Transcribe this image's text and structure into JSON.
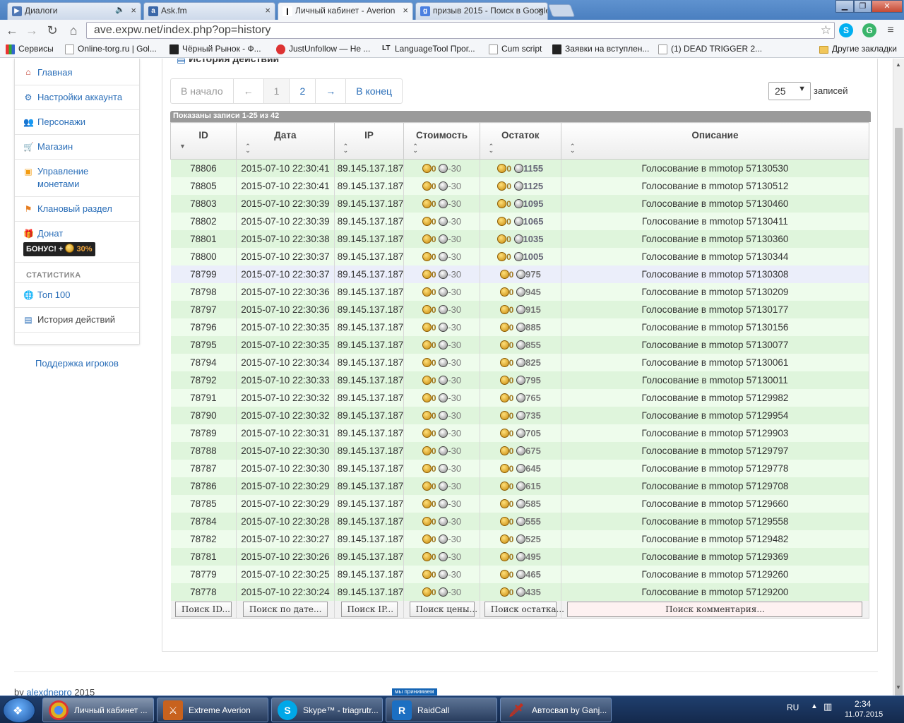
{
  "browser": {
    "tabs": [
      {
        "label": "Диалоги",
        "icon": "play-icon",
        "color": "#4f78b5"
      },
      {
        "label": "Ask.fm",
        "icon": "ask-icon",
        "color": "#3a67a8"
      },
      {
        "label": "Личный кабинет - Averion",
        "icon": "info-icon",
        "color": "#222222"
      },
      {
        "label": "призыв 2015 - Поиск в Google",
        "icon": "google-icon",
        "color": "#4a7fe0"
      }
    ],
    "url": "ave.expw.net/index.php?op=history",
    "bookmarks": [
      {
        "label": "Сервисы"
      },
      {
        "label": "Online-torg.ru | Gol..."
      },
      {
        "label": "Чёрный Рынок - Ф..."
      },
      {
        "label": "JustUnfollow — Не ..."
      },
      {
        "label": "LanguageTool Прог..."
      },
      {
        "label": "Cum script"
      },
      {
        "label": "Заявки на вступлен..."
      },
      {
        "label": "(1) DEAD TRIGGER 2..."
      },
      {
        "label": "Другие закладки"
      }
    ]
  },
  "sidebar": {
    "items": [
      {
        "label": "Главная",
        "icon": "home-icon"
      },
      {
        "label": "Настройки аккаунта",
        "icon": "gear-icon"
      },
      {
        "label": "Персонажи",
        "icon": "users-icon"
      },
      {
        "label": "Магазин",
        "icon": "cart-icon"
      },
      {
        "label": "Управление монетами",
        "icon": "coins-icon"
      },
      {
        "label": "Клановый раздел",
        "icon": "flag-icon"
      },
      {
        "label": "Донат",
        "icon": "gift-icon"
      }
    ],
    "bonus": {
      "text": "БОНУС! +",
      "pct": "30%"
    },
    "stats_heading": "СТАТИСТИКА",
    "stats_items": [
      {
        "label": "Топ 100",
        "icon": "globe-icon"
      },
      {
        "label": "История действий",
        "icon": "document-icon"
      }
    ],
    "support": "Поддержка игроков"
  },
  "panel": {
    "title": "История действий",
    "pager": {
      "first": "В начало",
      "prev": "←",
      "page1": "1",
      "page2": "2",
      "next": "→",
      "last": "В конец"
    },
    "per_page_value": "25",
    "per_page_label": "записей",
    "shown": "Показаны записи 1-25 из 42",
    "columns": [
      "ID",
      "Дата",
      "IP",
      "Стоимость",
      "Остаток",
      "Описание"
    ],
    "filters": [
      "Поиск ID...",
      "Поиск по дате...",
      "Поиск IP...",
      "Поиск цены...",
      "Поиск остатка...",
      "Поиск комментария..."
    ]
  },
  "rows": [
    {
      "id": "78806",
      "date": "2015-07-10 22:30:41",
      "ip": "89.145.137.187",
      "cost_gold": "0",
      "cost_silver": "-30",
      "bal_gold": "0",
      "bal_silver": "1155",
      "desc": "Голосование в mmotop 57130530"
    },
    {
      "id": "78805",
      "date": "2015-07-10 22:30:41",
      "ip": "89.145.137.187",
      "cost_gold": "0",
      "cost_silver": "-30",
      "bal_gold": "0",
      "bal_silver": "1125",
      "desc": "Голосование в mmotop 57130512"
    },
    {
      "id": "78803",
      "date": "2015-07-10 22:30:39",
      "ip": "89.145.137.187",
      "cost_gold": "0",
      "cost_silver": "-30",
      "bal_gold": "0",
      "bal_silver": "1095",
      "desc": "Голосование в mmotop 57130460"
    },
    {
      "id": "78802",
      "date": "2015-07-10 22:30:39",
      "ip": "89.145.137.187",
      "cost_gold": "0",
      "cost_silver": "-30",
      "bal_gold": "0",
      "bal_silver": "1065",
      "desc": "Голосование в mmotop 57130411"
    },
    {
      "id": "78801",
      "date": "2015-07-10 22:30:38",
      "ip": "89.145.137.187",
      "cost_gold": "0",
      "cost_silver": "-30",
      "bal_gold": "0",
      "bal_silver": "1035",
      "desc": "Голосование в mmotop 57130360"
    },
    {
      "id": "78800",
      "date": "2015-07-10 22:30:37",
      "ip": "89.145.137.187",
      "cost_gold": "0",
      "cost_silver": "-30",
      "bal_gold": "0",
      "bal_silver": "1005",
      "desc": "Голосование в mmotop 57130344"
    },
    {
      "id": "78799",
      "date": "2015-07-10 22:30:37",
      "ip": "89.145.137.187",
      "cost_gold": "0",
      "cost_silver": "-30",
      "bal_gold": "0",
      "bal_silver": "975",
      "desc": "Голосование в mmotop 57130308"
    },
    {
      "id": "78798",
      "date": "2015-07-10 22:30:36",
      "ip": "89.145.137.187",
      "cost_gold": "0",
      "cost_silver": "-30",
      "bal_gold": "0",
      "bal_silver": "945",
      "desc": "Голосование в mmotop 57130209"
    },
    {
      "id": "78797",
      "date": "2015-07-10 22:30:36",
      "ip": "89.145.137.187",
      "cost_gold": "0",
      "cost_silver": "-30",
      "bal_gold": "0",
      "bal_silver": "915",
      "desc": "Голосование в mmotop 57130177"
    },
    {
      "id": "78796",
      "date": "2015-07-10 22:30:35",
      "ip": "89.145.137.187",
      "cost_gold": "0",
      "cost_silver": "-30",
      "bal_gold": "0",
      "bal_silver": "885",
      "desc": "Голосование в mmotop 57130156"
    },
    {
      "id": "78795",
      "date": "2015-07-10 22:30:35",
      "ip": "89.145.137.187",
      "cost_gold": "0",
      "cost_silver": "-30",
      "bal_gold": "0",
      "bal_silver": "855",
      "desc": "Голосование в mmotop 57130077"
    },
    {
      "id": "78794",
      "date": "2015-07-10 22:30:34",
      "ip": "89.145.137.187",
      "cost_gold": "0",
      "cost_silver": "-30",
      "bal_gold": "0",
      "bal_silver": "825",
      "desc": "Голосование в mmotop 57130061"
    },
    {
      "id": "78792",
      "date": "2015-07-10 22:30:33",
      "ip": "89.145.137.187",
      "cost_gold": "0",
      "cost_silver": "-30",
      "bal_gold": "0",
      "bal_silver": "795",
      "desc": "Голосование в mmotop 57130011"
    },
    {
      "id": "78791",
      "date": "2015-07-10 22:30:32",
      "ip": "89.145.137.187",
      "cost_gold": "0",
      "cost_silver": "-30",
      "bal_gold": "0",
      "bal_silver": "765",
      "desc": "Голосование в mmotop 57129982"
    },
    {
      "id": "78790",
      "date": "2015-07-10 22:30:32",
      "ip": "89.145.137.187",
      "cost_gold": "0",
      "cost_silver": "-30",
      "bal_gold": "0",
      "bal_silver": "735",
      "desc": "Голосование в mmotop 57129954"
    },
    {
      "id": "78789",
      "date": "2015-07-10 22:30:31",
      "ip": "89.145.137.187",
      "cost_gold": "0",
      "cost_silver": "-30",
      "bal_gold": "0",
      "bal_silver": "705",
      "desc": "Голосование в mmotop 57129903"
    },
    {
      "id": "78788",
      "date": "2015-07-10 22:30:30",
      "ip": "89.145.137.187",
      "cost_gold": "0",
      "cost_silver": "-30",
      "bal_gold": "0",
      "bal_silver": "675",
      "desc": "Голосование в mmotop 57129797"
    },
    {
      "id": "78787",
      "date": "2015-07-10 22:30:30",
      "ip": "89.145.137.187",
      "cost_gold": "0",
      "cost_silver": "-30",
      "bal_gold": "0",
      "bal_silver": "645",
      "desc": "Голосование в mmotop 57129778"
    },
    {
      "id": "78786",
      "date": "2015-07-10 22:30:29",
      "ip": "89.145.137.187",
      "cost_gold": "0",
      "cost_silver": "-30",
      "bal_gold": "0",
      "bal_silver": "615",
      "desc": "Голосование в mmotop 57129708"
    },
    {
      "id": "78785",
      "date": "2015-07-10 22:30:29",
      "ip": "89.145.137.187",
      "cost_gold": "0",
      "cost_silver": "-30",
      "bal_gold": "0",
      "bal_silver": "585",
      "desc": "Голосование в mmotop 57129660"
    },
    {
      "id": "78784",
      "date": "2015-07-10 22:30:28",
      "ip": "89.145.137.187",
      "cost_gold": "0",
      "cost_silver": "-30",
      "bal_gold": "0",
      "bal_silver": "555",
      "desc": "Голосование в mmotop 57129558"
    },
    {
      "id": "78782",
      "date": "2015-07-10 22:30:27",
      "ip": "89.145.137.187",
      "cost_gold": "0",
      "cost_silver": "-30",
      "bal_gold": "0",
      "bal_silver": "525",
      "desc": "Голосование в mmotop 57129482"
    },
    {
      "id": "78781",
      "date": "2015-07-10 22:30:26",
      "ip": "89.145.137.187",
      "cost_gold": "0",
      "cost_silver": "-30",
      "bal_gold": "0",
      "bal_silver": "495",
      "desc": "Голосование в mmotop 57129369"
    },
    {
      "id": "78779",
      "date": "2015-07-10 22:30:25",
      "ip": "89.145.137.187",
      "cost_gold": "0",
      "cost_silver": "-30",
      "bal_gold": "0",
      "bal_silver": "465",
      "desc": "Голосование в mmotop 57129260"
    },
    {
      "id": "78778",
      "date": "2015-07-10 22:30:24",
      "ip": "89.145.137.187",
      "cost_gold": "0",
      "cost_silver": "-30",
      "bal_gold": "0",
      "bal_silver": "435",
      "desc": "Голосование в mmotop 57129200"
    }
  ],
  "footer": {
    "prefix": "by",
    "author": "alexdnepro",
    "year": "2015"
  },
  "taskbar": {
    "badge": "мы принимаем",
    "items": [
      {
        "label": "Личный кабинет ...",
        "icon": "chrome-icon",
        "color": "#e0b020"
      },
      {
        "label": "Extreme Averion",
        "icon": "game-icon",
        "color": "#c8621e"
      },
      {
        "label": "Skype™ - triagrutr...",
        "icon": "skype-icon",
        "color": "#00a8e8"
      },
      {
        "label": "RaidCall",
        "icon": "raidcall-icon",
        "color": "#1c6fc2"
      },
      {
        "label": "Автосвап by Ganj...",
        "icon": "knife-icon",
        "color": "#c03020"
      }
    ],
    "lang": "RU",
    "time": "2:34",
    "date": "11.07.2015"
  }
}
